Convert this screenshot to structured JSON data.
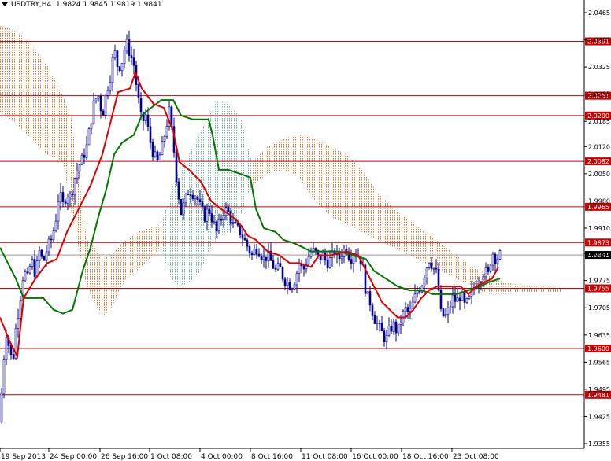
{
  "title": {
    "symbol": "USDTRY,H4",
    "ohlc": "1.9824 1.9845 1.9819 1.9841"
  },
  "chart_data": {
    "type": "candlestick",
    "y_ticks": [
      "2.0465",
      "2.0395",
      "2.0325",
      "2.0255",
      "2.0185",
      "2.0120",
      "2.0050",
      "1.9980",
      "1.9910",
      "1.9845",
      "1.9775",
      "1.9705",
      "1.9635",
      "1.9565",
      "1.9495",
      "1.9425",
      "1.9355"
    ],
    "x_ticks": [
      "19 Sep 2013",
      "24 Sep 00:00",
      "26 Sep 16:00",
      "1 Oct 08:00",
      "4 Oct 00:00",
      "8 Oct 16:00",
      "11 Oct 08:00",
      "16 Oct 00:00",
      "18 Oct 16:00",
      "23 Oct 08:00"
    ],
    "levels": [
      {
        "value": 2.0391,
        "label": "2.0391"
      },
      {
        "value": 2.0251,
        "label": "2.0251"
      },
      {
        "value": 2.02,
        "label": "2.0200"
      },
      {
        "value": 2.0082,
        "label": "2.0082"
      },
      {
        "value": 1.9965,
        "label": "1.9965"
      },
      {
        "value": 1.9873,
        "label": "1.9873"
      },
      {
        "value": 1.9755,
        "label": "1.9755"
      },
      {
        "value": 1.96,
        "label": "1.9600"
      },
      {
        "value": 1.9481,
        "label": "1.9481"
      }
    ],
    "current": {
      "value": 1.9841,
      "label": "1.9841"
    },
    "ylim": [
      1.9355,
      2.0465
    ],
    "colors": {
      "level_line": "#cc0000",
      "level_box": "#cc0000",
      "tenkan": "#dd0000",
      "kijun": "#007700",
      "cloud_bear": "#d2691e",
      "cloud_bull": "#66aa99",
      "candle": "#00008b",
      "price_box": "#000000"
    },
    "close_path": [
      [
        0,
        1.941
      ],
      [
        4,
        1.956
      ],
      [
        8,
        1.964
      ],
      [
        12,
        1.96
      ],
      [
        16,
        1.956
      ],
      [
        20,
        1.965
      ],
      [
        25,
        1.972
      ],
      [
        30,
        1.98
      ],
      [
        35,
        1.978
      ],
      [
        40,
        1.983
      ],
      [
        45,
        1.979
      ],
      [
        50,
        1.985
      ],
      [
        55,
        1.982
      ],
      [
        60,
        1.986
      ],
      [
        65,
        1.988
      ],
      [
        70,
        1.992
      ],
      [
        75,
        2.0
      ],
      [
        80,
        1.997
      ],
      [
        85,
        2.0
      ],
      [
        90,
        1.999
      ],
      [
        95,
        2.004
      ],
      [
        100,
        2.007
      ],
      [
        105,
        2.009
      ],
      [
        110,
        2.012
      ],
      [
        115,
        2.018
      ],
      [
        120,
        2.024
      ],
      [
        125,
        2.025
      ],
      [
        130,
        2.02
      ],
      [
        135,
        2.026
      ],
      [
        140,
        2.03
      ],
      [
        145,
        2.037
      ],
      [
        150,
        2.032
      ],
      [
        155,
        2.034
      ],
      [
        160,
        2.039
      ],
      [
        165,
        2.036
      ],
      [
        170,
        2.033
      ],
      [
        175,
        2.025
      ],
      [
        180,
        2.018
      ],
      [
        185,
        2.02
      ],
      [
        190,
        2.014
      ],
      [
        195,
        2.01
      ],
      [
        200,
        2.008
      ],
      [
        205,
        2.011
      ],
      [
        210,
        2.016
      ],
      [
        215,
        2.021
      ],
      [
        220,
        2.013
      ],
      [
        225,
        2.002
      ],
      [
        230,
        1.995
      ],
      [
        235,
        1.998
      ],
      [
        240,
        2.001
      ],
      [
        245,
        2.0
      ],
      [
        250,
        1.999
      ],
      [
        255,
        1.996
      ],
      [
        260,
        1.994
      ],
      [
        265,
        1.996
      ],
      [
        270,
        1.993
      ],
      [
        275,
        1.99
      ],
      [
        280,
        1.993
      ],
      [
        285,
        1.996
      ],
      [
        290,
        1.995
      ],
      [
        295,
        1.992
      ],
      [
        300,
        1.991
      ],
      [
        305,
        1.99
      ],
      [
        310,
        1.988
      ],
      [
        315,
        1.986
      ],
      [
        320,
        1.984
      ],
      [
        325,
        1.986
      ],
      [
        330,
        1.985
      ],
      [
        335,
        1.983
      ],
      [
        340,
        1.984
      ],
      [
        345,
        1.982
      ],
      [
        350,
        1.98
      ],
      [
        355,
        1.981
      ],
      [
        360,
        1.978
      ],
      [
        365,
        1.977
      ],
      [
        370,
        1.976
      ],
      [
        375,
        1.978
      ],
      [
        380,
        1.982
      ],
      [
        385,
        1.98
      ],
      [
        390,
        1.983
      ],
      [
        395,
        1.985
      ],
      [
        400,
        1.985
      ],
      [
        405,
        1.983
      ],
      [
        410,
        1.984
      ],
      [
        415,
        1.982
      ],
      [
        420,
        1.983
      ],
      [
        425,
        1.985
      ],
      [
        430,
        1.983
      ],
      [
        435,
        1.985
      ],
      [
        440,
        1.986
      ],
      [
        445,
        1.983
      ],
      [
        450,
        1.985
      ],
      [
        455,
        1.984
      ],
      [
        460,
        1.982
      ],
      [
        465,
        1.974
      ],
      [
        470,
        1.972
      ],
      [
        475,
        1.968
      ],
      [
        480,
        1.966
      ],
      [
        485,
        1.964
      ],
      [
        490,
        1.962
      ],
      [
        495,
        1.965
      ],
      [
        500,
        1.966
      ],
      [
        505,
        1.964
      ],
      [
        510,
        1.968
      ],
      [
        515,
        1.97
      ],
      [
        520,
        1.969
      ],
      [
        525,
        1.972
      ],
      [
        530,
        1.975
      ],
      [
        535,
        1.976
      ],
      [
        540,
        1.98
      ],
      [
        545,
        1.983
      ],
      [
        550,
        1.981
      ],
      [
        555,
        1.979
      ],
      [
        560,
        1.969
      ],
      [
        565,
        1.968
      ],
      [
        570,
        1.97
      ],
      [
        575,
        1.973
      ],
      [
        580,
        1.972
      ],
      [
        585,
        1.974
      ],
      [
        590,
        1.971
      ],
      [
        595,
        1.972
      ],
      [
        600,
        1.975
      ],
      [
        605,
        1.977
      ],
      [
        610,
        1.978
      ],
      [
        615,
        1.98
      ],
      [
        620,
        1.979
      ],
      [
        625,
        1.985
      ],
      [
        630,
        1.983
      ],
      [
        635,
        1.9841
      ]
    ],
    "tenkan": [
      [
        0,
        1.968
      ],
      [
        12,
        1.962
      ],
      [
        22,
        1.958
      ],
      [
        30,
        1.973
      ],
      [
        45,
        1.978
      ],
      [
        60,
        1.982
      ],
      [
        72,
        1.983
      ],
      [
        85,
        1.99
      ],
      [
        100,
        1.996
      ],
      [
        115,
        2.002
      ],
      [
        130,
        2.01
      ],
      [
        140,
        2.018
      ],
      [
        150,
        2.026
      ],
      [
        165,
        2.027
      ],
      [
        172,
        2.031
      ],
      [
        180,
        2.027
      ],
      [
        195,
        2.023
      ],
      [
        208,
        2.022
      ],
      [
        220,
        2.016
      ],
      [
        228,
        2.008
      ],
      [
        240,
        2.006
      ],
      [
        255,
        2.003
      ],
      [
        268,
        1.998
      ],
      [
        280,
        1.996
      ],
      [
        295,
        1.994
      ],
      [
        305,
        1.992
      ],
      [
        315,
        1.989
      ],
      [
        325,
        1.988
      ],
      [
        340,
        1.985
      ],
      [
        355,
        1.984
      ],
      [
        368,
        1.982
      ],
      [
        380,
        1.982
      ],
      [
        395,
        1.981
      ],
      [
        405,
        1.984
      ],
      [
        420,
        1.984
      ],
      [
        440,
        1.985
      ],
      [
        455,
        1.984
      ],
      [
        465,
        1.98
      ],
      [
        475,
        1.976
      ],
      [
        485,
        1.972
      ],
      [
        495,
        1.97
      ],
      [
        505,
        1.968
      ],
      [
        515,
        1.968
      ],
      [
        525,
        1.97
      ],
      [
        535,
        1.973
      ],
      [
        545,
        1.975
      ],
      [
        555,
        1.976
      ],
      [
        570,
        1.976
      ],
      [
        585,
        1.976
      ],
      [
        595,
        1.974
      ],
      [
        605,
        1.976
      ],
      [
        615,
        1.977
      ],
      [
        625,
        1.978
      ],
      [
        633,
        1.981
      ]
    ],
    "kijun": [
      [
        0,
        1.986
      ],
      [
        10,
        1.982
      ],
      [
        20,
        1.978
      ],
      [
        30,
        1.973
      ],
      [
        40,
        1.973
      ],
      [
        55,
        1.973
      ],
      [
        68,
        1.97
      ],
      [
        80,
        1.969
      ],
      [
        92,
        1.97
      ],
      [
        105,
        1.98
      ],
      [
        115,
        1.986
      ],
      [
        125,
        1.994
      ],
      [
        135,
        2.001
      ],
      [
        145,
        2.01
      ],
      [
        155,
        2.013
      ],
      [
        170,
        2.015
      ],
      [
        180,
        2.02
      ],
      [
        192,
        2.022
      ],
      [
        205,
        2.024
      ],
      [
        220,
        2.024
      ],
      [
        230,
        2.02
      ],
      [
        245,
        2.019
      ],
      [
        265,
        2.019
      ],
      [
        270,
        2.015
      ],
      [
        278,
        2.006
      ],
      [
        290,
        2.006
      ],
      [
        305,
        2.005
      ],
      [
        318,
        2.004
      ],
      [
        325,
        1.996
      ],
      [
        335,
        1.991
      ],
      [
        350,
        1.99
      ],
      [
        360,
        1.988
      ],
      [
        375,
        1.987
      ],
      [
        395,
        1.985
      ],
      [
        410,
        1.985
      ],
      [
        430,
        1.985
      ],
      [
        450,
        1.984
      ],
      [
        465,
        1.983
      ],
      [
        475,
        1.98
      ],
      [
        490,
        1.978
      ],
      [
        505,
        1.976
      ],
      [
        520,
        1.975
      ],
      [
        535,
        1.975
      ],
      [
        550,
        1.974
      ],
      [
        565,
        1.974
      ],
      [
        580,
        1.974
      ],
      [
        595,
        1.975
      ],
      [
        610,
        1.976
      ],
      [
        620,
        1.977
      ],
      [
        635,
        1.978
      ]
    ],
    "cloud_bear": [
      [
        0,
        2.043,
        2.021
      ],
      [
        20,
        2.042,
        2.018
      ],
      [
        40,
        2.038,
        2.014
      ],
      [
        60,
        2.033,
        2.01
      ],
      [
        80,
        2.025,
        2.008
      ],
      [
        90,
        2.02,
        1.996
      ],
      [
        100,
        2.005,
        1.986
      ],
      [
        110,
        1.988,
        1.976
      ],
      [
        120,
        1.986,
        1.972
      ],
      [
        130,
        1.983,
        1.968
      ],
      [
        140,
        1.984,
        1.97
      ],
      [
        150,
        1.986,
        1.974
      ],
      [
        160,
        1.988,
        1.978
      ],
      [
        175,
        1.99,
        1.98
      ],
      [
        190,
        1.991,
        1.983
      ],
      [
        205,
        1.992,
        1.986
      ],
      [
        320,
        2.008,
        2.002
      ],
      [
        340,
        2.012,
        2.005
      ],
      [
        360,
        2.014,
        2.006
      ],
      [
        380,
        2.015,
        2.004
      ],
      [
        400,
        2.014,
        1.998
      ],
      [
        420,
        2.012,
        1.994
      ],
      [
        440,
        2.01,
        1.992
      ],
      [
        460,
        2.006,
        1.99
      ],
      [
        480,
        2.0,
        1.988
      ],
      [
        500,
        1.996,
        1.986
      ],
      [
        520,
        1.993,
        1.984
      ],
      [
        540,
        1.99,
        1.982
      ],
      [
        560,
        1.987,
        1.98
      ],
      [
        580,
        1.984,
        1.978
      ],
      [
        600,
        1.981,
        1.976
      ],
      [
        620,
        1.979,
        1.974
      ],
      [
        640,
        1.977,
        1.974
      ],
      [
        660,
        1.9765,
        1.9745
      ],
      [
        680,
        1.976,
        1.9745
      ],
      [
        700,
        1.976,
        1.9745
      ],
      [
        712,
        1.9758,
        1.9745
      ]
    ],
    "cloud_bull": [
      [
        205,
        1.992,
        1.986
      ],
      [
        215,
        1.999,
        1.979
      ],
      [
        225,
        2.005,
        1.976
      ],
      [
        240,
        2.01,
        1.977
      ],
      [
        255,
        2.016,
        1.98
      ],
      [
        265,
        2.02,
        1.985
      ],
      [
        275,
        2.024,
        1.988
      ],
      [
        290,
        2.023,
        1.99
      ],
      [
        305,
        2.02,
        1.994
      ],
      [
        320,
        2.008,
        2.002
      ]
    ]
  }
}
